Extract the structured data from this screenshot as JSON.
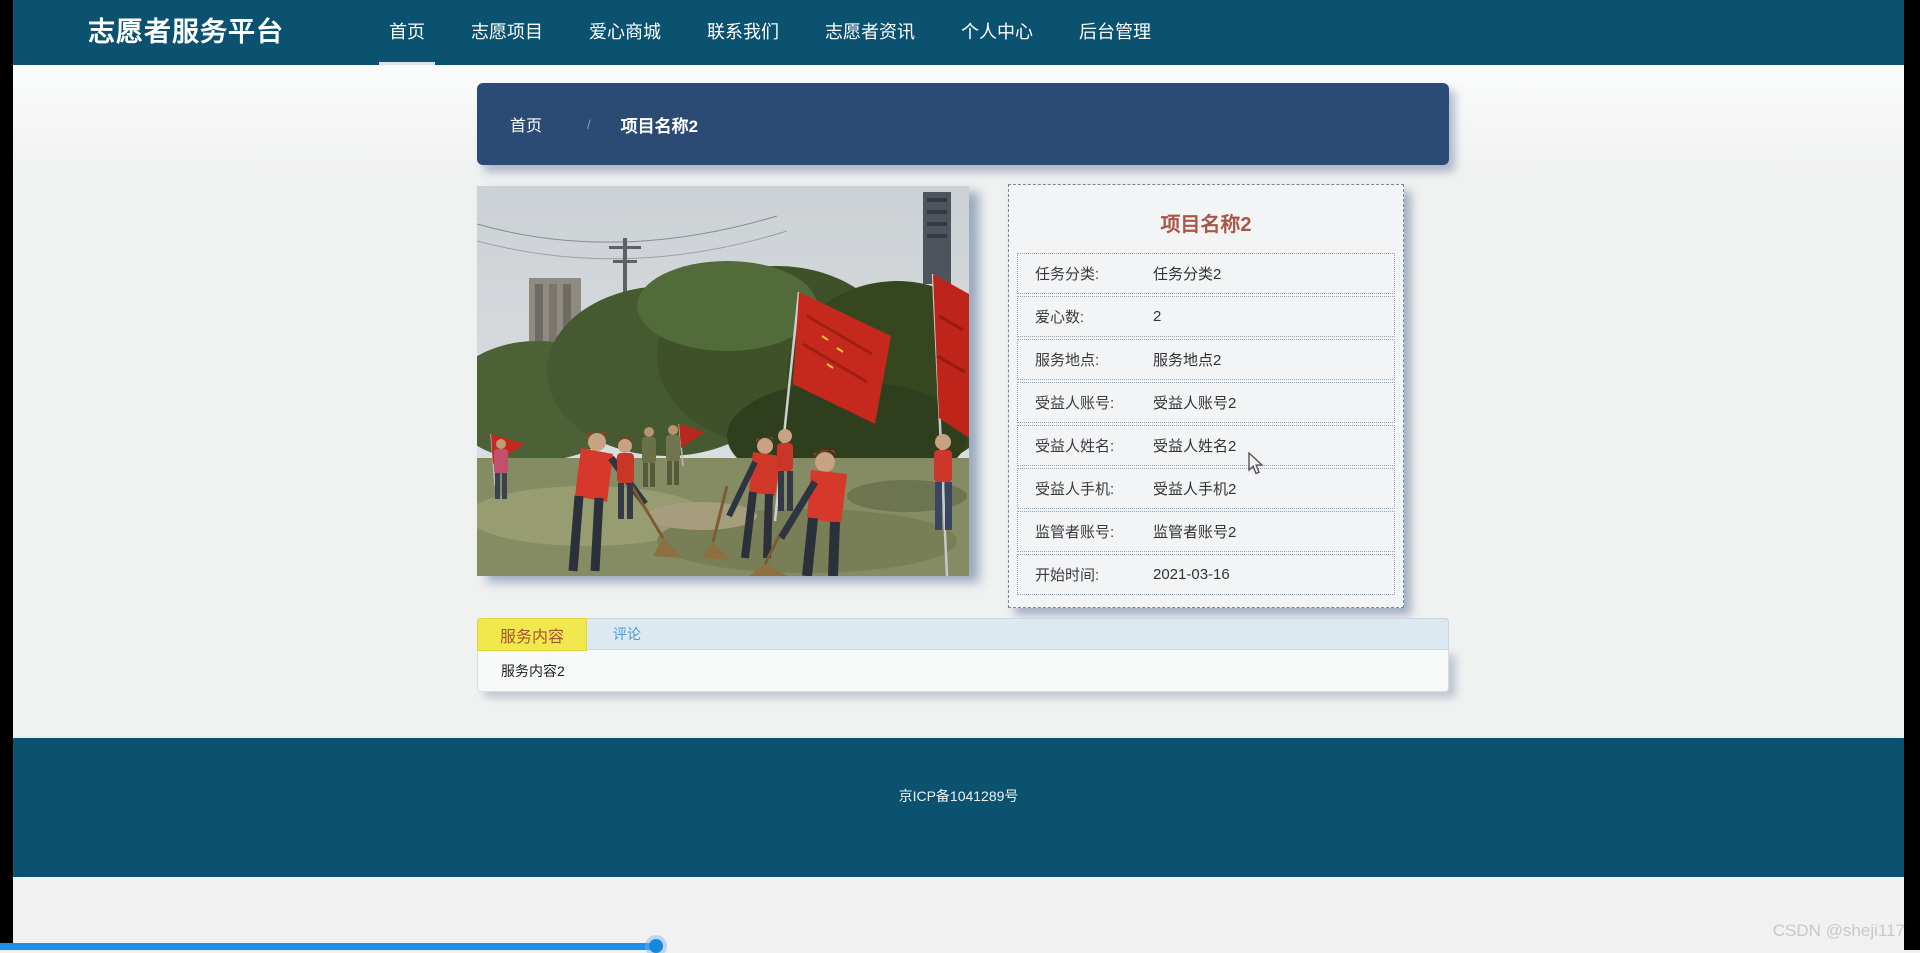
{
  "page": {
    "background": "#f0f1f1",
    "watermark": "CSDN @sheji117"
  },
  "navbar": {
    "bg_color": "#0b5170",
    "brand": "志愿者服务平台",
    "items": [
      {
        "label": "首页",
        "active": true
      },
      {
        "label": "志愿项目",
        "active": false
      },
      {
        "label": "爱心商城",
        "active": false
      },
      {
        "label": "联系我们",
        "active": false
      },
      {
        "label": "志愿者资讯",
        "active": false
      },
      {
        "label": "个人中心",
        "active": false
      },
      {
        "label": "后台管理",
        "active": false
      }
    ]
  },
  "breadcrumb": {
    "bg_color": "#2b4b75",
    "home": "首页",
    "separator": "/",
    "current": "项目名称2"
  },
  "photo": {
    "description": "volunteers in red vests sweeping field with red flags"
  },
  "detail": {
    "title": "项目名称2",
    "title_color": "#a85747",
    "rows": [
      {
        "label": "任务分类:",
        "value": "任务分类2"
      },
      {
        "label": "爱心数:",
        "value": "2"
      },
      {
        "label": "服务地点:",
        "value": "服务地点2"
      },
      {
        "label": "受益人账号:",
        "value": "受益人账号2"
      },
      {
        "label": "受益人姓名:",
        "value": "受益人姓名2"
      },
      {
        "label": "受益人手机:",
        "value": "受益人手机2"
      },
      {
        "label": "监管者账号:",
        "value": "监管者账号2"
      },
      {
        "label": "开始时间:",
        "value": "2021-03-16"
      }
    ]
  },
  "tabs": {
    "active_label": "服务内容",
    "active_bg": "#f0e94e",
    "active_color": "#a5542e",
    "comment_label": "评论",
    "comment_color": "#4a9cd5",
    "content_text": "服务内容2"
  },
  "footer": {
    "bg_color": "#0b5170",
    "icp": "京ICP备1041289号"
  },
  "player": {
    "progress_color": "#1d8fe9",
    "progress_percent": 34
  }
}
